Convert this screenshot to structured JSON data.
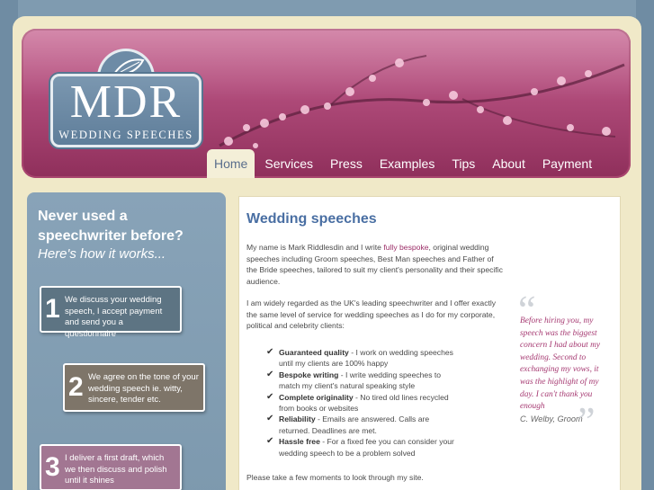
{
  "logo": {
    "title": "MDR",
    "subtitle": "WEDDING SPEECHES"
  },
  "nav": {
    "items": [
      {
        "label": "Home",
        "active": true
      },
      {
        "label": "Services"
      },
      {
        "label": "Press"
      },
      {
        "label": "Examples"
      },
      {
        "label": "Tips"
      },
      {
        "label": "About"
      },
      {
        "label": "Payment"
      }
    ]
  },
  "sidebar": {
    "title": "Never used a speechwriter before?",
    "subtitle": "Here's how it works...",
    "steps": [
      {
        "number": "1",
        "text": "We discuss your wedding speech, I accept payment and send you a questionnaire"
      },
      {
        "number": "2",
        "text": "We agree on the tone of your wedding  speech ie. witty, sincere, tender etc."
      },
      {
        "number": "3",
        "text": "I deliver a first draft, which we then discuss and polish until it shines"
      }
    ]
  },
  "main": {
    "title": "Wedding speeches",
    "para1_before": "My name is Mark Riddlesdin and I write ",
    "para1_link": "fully bespoke",
    "para1_after": ", original wedding speeches including Groom speeches, Best Man speeches and Father of the Bride speeches, tailored to suit my client's personality and their specific audience.",
    "para2": "I am widely regarded as the UK's leading speechwriter and I offer exactly the same level of service for wedding speeches as I do for my corporate, political and celebrity clients:",
    "checklist": [
      {
        "bold": "Guaranteed quality",
        "text": " - I work on wedding speeches until my clients are 100% happy"
      },
      {
        "bold": "Bespoke writing",
        "text": " - I write wedding speeches to match my client's natural speaking style"
      },
      {
        "bold": "Complete originality",
        "text": " - No tired old lines recycled from books or websites"
      },
      {
        "bold": "Reliability",
        "text": " - Emails are answered. Calls are returned. Deadlines are met."
      },
      {
        "bold": "Hassle free",
        "text": " - For a fixed fee you can consider your wedding speech to be a problem solved"
      }
    ],
    "para3": "Please take a few moments to look through my site."
  },
  "testimonial": {
    "open_mark": "“",
    "close_mark": "”",
    "text": "Before hiring you, my speech was the biggest concern I had about my wedding. Second to exchanging my vows, it was the highlight of my day. I can't thank you enough",
    "author": "C. Welby, Groom"
  },
  "colors": {
    "accent": "#b24d7c",
    "sidebar": "#7f9bb0",
    "link": "#9c2e68",
    "title": "#4a6fa3"
  },
  "icons": {
    "check": "check-icon",
    "logo_ornament": "leaf-icon"
  }
}
